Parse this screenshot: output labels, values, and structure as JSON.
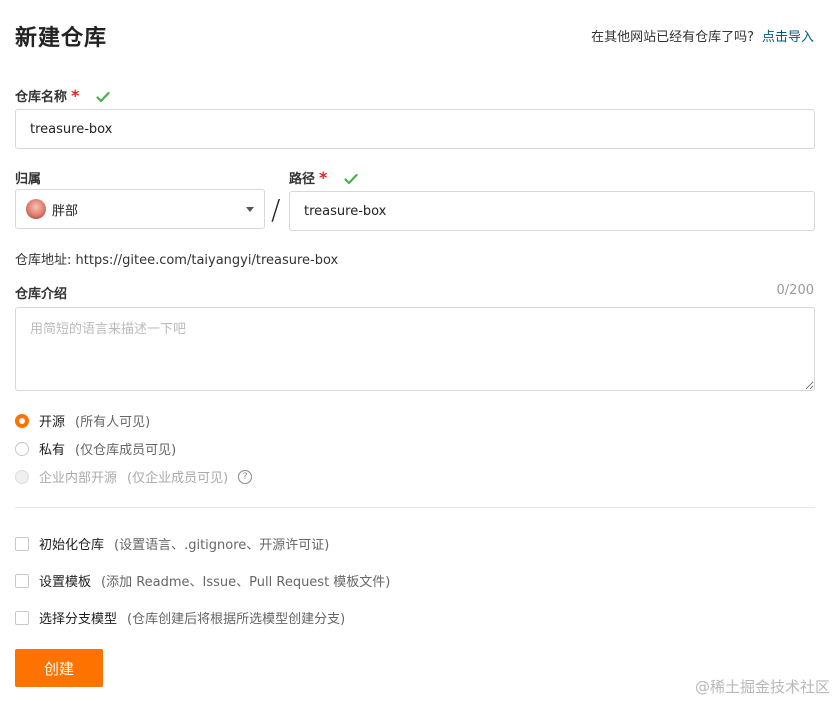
{
  "page": {
    "title": "新建仓库",
    "import_question": "在其他网站已经有仓库了吗?",
    "import_link": "点击导入"
  },
  "repo_name": {
    "label": "仓库名称",
    "required_mark": "*",
    "value": "treasure-box",
    "valid": true
  },
  "owner": {
    "label": "归属",
    "selected": "胖部"
  },
  "separator": "/",
  "path": {
    "label": "路径",
    "required_mark": "*",
    "value": "treasure-box",
    "valid": true
  },
  "address": {
    "text": "仓库地址: https://gitee.com/taiyangyi/treasure-box"
  },
  "description": {
    "label": "仓库介绍",
    "counter": "0/200",
    "placeholder": "用简短的语言来描述一下吧"
  },
  "visibility": {
    "options": [
      {
        "label": "开源",
        "note": "(所有人可见)",
        "checked": true,
        "disabled": false
      },
      {
        "label": "私有",
        "note": "(仅仓库成员可见)",
        "checked": false,
        "disabled": false
      },
      {
        "label": "企业内部开源",
        "note": "(仅企业成员可见)",
        "checked": false,
        "disabled": true
      }
    ],
    "help_icon": "?"
  },
  "init_options": [
    {
      "label": "初始化仓库",
      "note": "(设置语言、.gitignore、开源许可证)",
      "checked": false
    },
    {
      "label": "设置模板",
      "note": "(添加 Readme、Issue、Pull Request 模板文件)",
      "checked": false
    },
    {
      "label": "选择分支模型",
      "note": "(仓库创建后将根据所选模型创建分支)",
      "checked": false
    }
  ],
  "submit_label": "创建",
  "watermark": "@稀土掘金技术社区",
  "colors": {
    "accent": "#fe7300",
    "link": "#005980",
    "valid_check": "#4caf50",
    "required": "#e1251b"
  }
}
